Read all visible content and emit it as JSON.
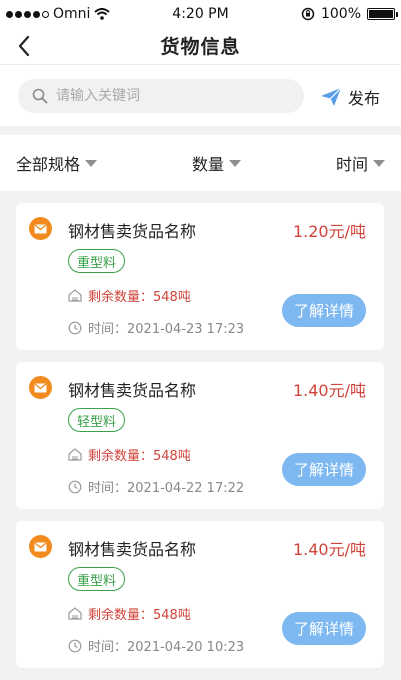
{
  "status_bar": {
    "carrier": "Omni",
    "time": "4:20 PM",
    "battery": "100%"
  },
  "nav": {
    "title": "货物信息"
  },
  "search": {
    "placeholder": "请输入关键词",
    "value": "",
    "publish_label": "发布"
  },
  "filters": [
    {
      "label": "全部规格"
    },
    {
      "label": "数量"
    },
    {
      "label": "时间"
    }
  ],
  "items": [
    {
      "name": "钢材售卖货品名称",
      "price": "1.20元/吨",
      "tag": "重型料",
      "stock": "剩余数量：548吨",
      "time": "时间：2021-04-23 17:23",
      "action": "了解详情"
    },
    {
      "name": "钢材售卖货品名称",
      "price": "1.40元/吨",
      "tag": "轻型料",
      "stock": "剩余数量：548吨",
      "time": "时间：2021-04-22 17:22",
      "action": "了解详情"
    },
    {
      "name": "钢材售卖货品名称",
      "price": "1.40元/吨",
      "tag": "重型料",
      "stock": "剩余数量：548吨",
      "time": "时间：2021-04-20 10:23",
      "action": "了解详情"
    }
  ],
  "colors": {
    "accent_orange": "#f28a1e",
    "price_red": "#d0433a",
    "tag_green": "#3aa04a",
    "button_blue": "#7eb8f1",
    "publish_icon_blue": "#5a9ee6"
  }
}
